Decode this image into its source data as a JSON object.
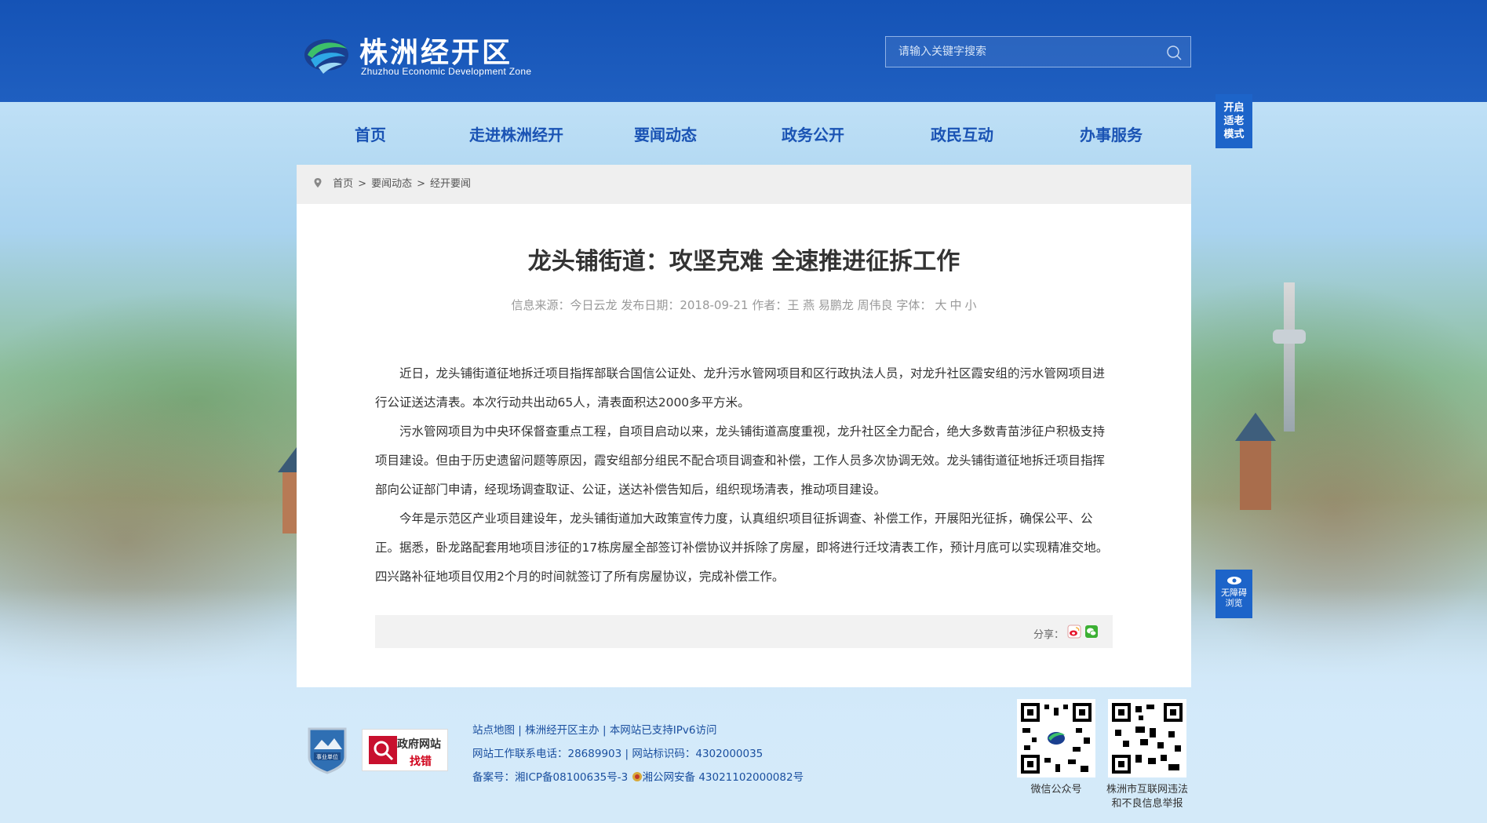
{
  "header": {
    "logo_title": "株洲经开区",
    "logo_subtitle": "Zhuzhou Economic Development Zone",
    "search_placeholder": "请输入关键字搜索"
  },
  "nav": {
    "items": [
      "首页",
      "走进株洲经开",
      "要闻动态",
      "政务公开",
      "政民互动",
      "办事服务"
    ]
  },
  "side": {
    "elder_mode": [
      "开启",
      "适老",
      "模式"
    ],
    "accessibility": [
      "无障碍",
      "浏览"
    ]
  },
  "breadcrumb": [
    "首页",
    "要闻动态",
    "经开要闻"
  ],
  "article": {
    "title": "龙头铺街道：攻坚克难 全速推进征拆工作",
    "meta_source_label": "信息来源：",
    "meta_source": "今日云龙",
    "meta_date_label": "发布日期：",
    "meta_date": "2018-09-21",
    "meta_author_label": "作者：",
    "meta_author": "王 燕 易鹏龙 周伟良",
    "meta_font_label": "字体：",
    "meta_font_options": [
      "大",
      "中",
      "小"
    ],
    "paragraphs": [
      "近日，龙头铺街道征地拆迁项目指挥部联合国信公证处、龙升污水管网项目和区行政执法人员，对龙升社区霞安组的污水管网项目进行公证送达清表。本次行动共出动65人，清表面积达2000多平方米。",
      "污水管网项目为中央环保督查重点工程，自项目启动以来，龙头铺街道高度重视，龙升社区全力配合，绝大多数青苗涉征户积极支持项目建设。但由于历史遗留问题等原因，霞安组部分组民不配合项目调查和补偿，工作人员多次协调无效。龙头铺街道征地拆迁项目指挥部向公证部门申请，经现场调查取证、公证，送达补偿告知后，组织现场清表，推动项目建设。",
      "今年是示范区产业项目建设年，龙头铺街道加大政策宣传力度，认真组织项目征拆调查、补偿工作，开展阳光征拆，确保公平、公正。据悉，卧龙路配套用地项目涉征的17栋房屋全部签订补偿协议并拆除了房屋，即将进行迁坟清表工作，预计月底可以实现精准交地。四兴路补征地项目仅用2个月的时间就签订了所有房屋协议，完成补偿工作。"
    ],
    "share_label": "分享："
  },
  "footer": {
    "badge_text": "事业单位",
    "gov_line1": "政府网站",
    "gov_line2": "找错",
    "links": [
      "站点地图",
      "株洲经开区主办",
      "本网站已支持IPv6访问"
    ],
    "phone_label": "网站工作联系电话：",
    "phone": "28689903",
    "site_id_label": "网站标识码：",
    "site_id": "4302000035",
    "record_label": "备案号：",
    "icp": "湘ICP备08100635号-3",
    "police": "湘公网安备 43021102000082号",
    "separator": "|",
    "qr1_caption": "微信公众号",
    "qr2_caption_l1": "株洲市互联网违法",
    "qr2_caption_l2": "和不良信息举报"
  },
  "colors": {
    "header_bg": "#1553b6",
    "nav_text": "#1a53b4",
    "side_button": "#1d64c9",
    "footer_link": "#1a4f9f"
  }
}
